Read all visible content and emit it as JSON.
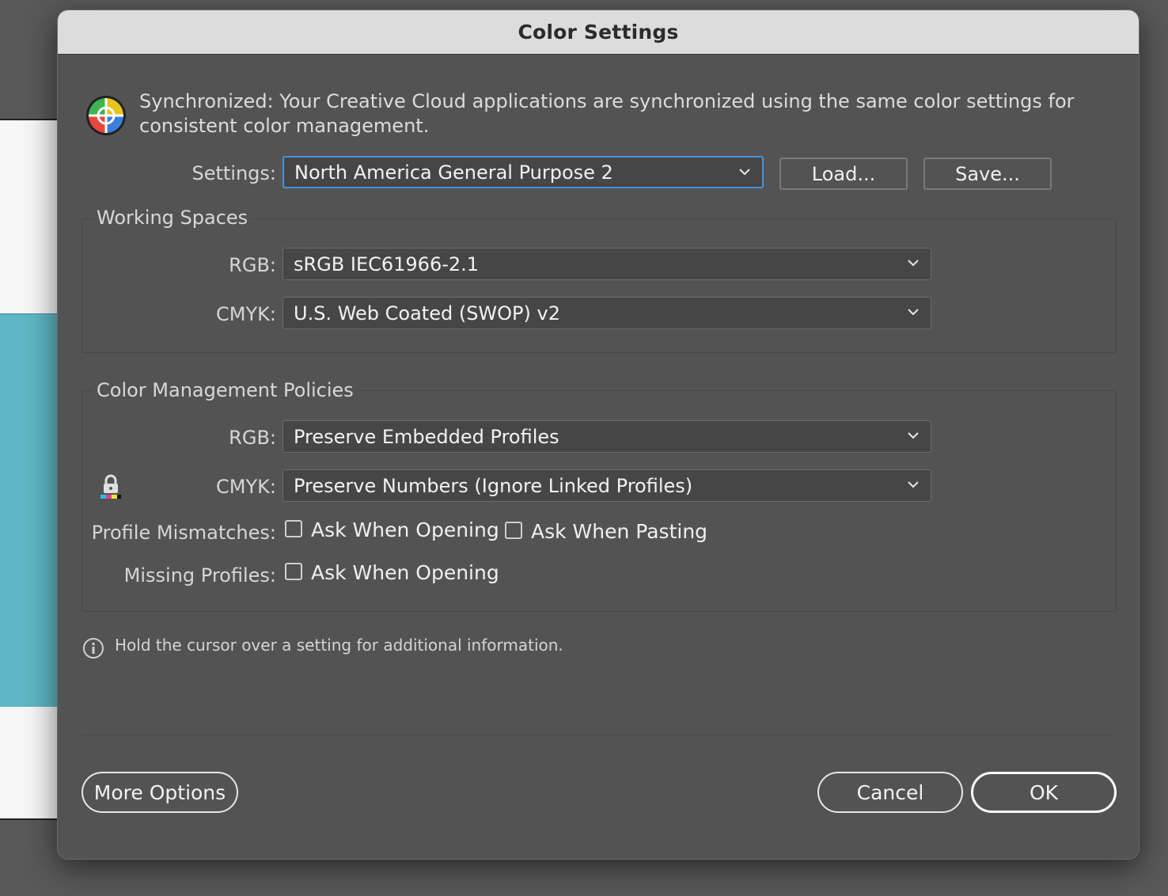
{
  "dialog": {
    "title": "Color Settings",
    "sync_message": "Synchronized: Your Creative Cloud applications are synchronized using the same color settings for consistent color management.",
    "settings": {
      "label": "Settings:",
      "value": "North America General Purpose 2",
      "load_label": "Load...",
      "save_label": "Save..."
    },
    "working_spaces": {
      "title": "Working Spaces",
      "rgb_label": "RGB:",
      "rgb_value": "sRGB IEC61966-2.1",
      "cmyk_label": "CMYK:",
      "cmyk_value": "U.S. Web Coated (SWOP) v2"
    },
    "policies": {
      "title": "Color Management Policies",
      "rgb_label": "RGB:",
      "rgb_value": "Preserve Embedded Profiles",
      "cmyk_label": "CMYK:",
      "cmyk_value": "Preserve Numbers (Ignore Linked Profiles)",
      "mismatches_label": "Profile Mismatches:",
      "mismatch_open_label": "Ask When Opening",
      "mismatch_open_checked": false,
      "mismatch_paste_label": "Ask When Pasting",
      "mismatch_paste_checked": false,
      "missing_label": "Missing Profiles:",
      "missing_open_label": "Ask When Opening",
      "missing_open_checked": false
    },
    "info_text": "Hold the cursor over a setting for additional information.",
    "buttons": {
      "more_options": "More Options",
      "cancel": "Cancel",
      "ok": "OK"
    }
  },
  "icons": {
    "sync": "color-wheel-icon",
    "lock": "lock-icon",
    "info": "info-icon",
    "chevron": "chevron-down-icon"
  },
  "colors": {
    "dialog_bg": "#535353",
    "titlebar_bg": "#dcdcdc",
    "focus_ring": "#4a90d9",
    "canvas_teal": "#5fb7c5"
  }
}
